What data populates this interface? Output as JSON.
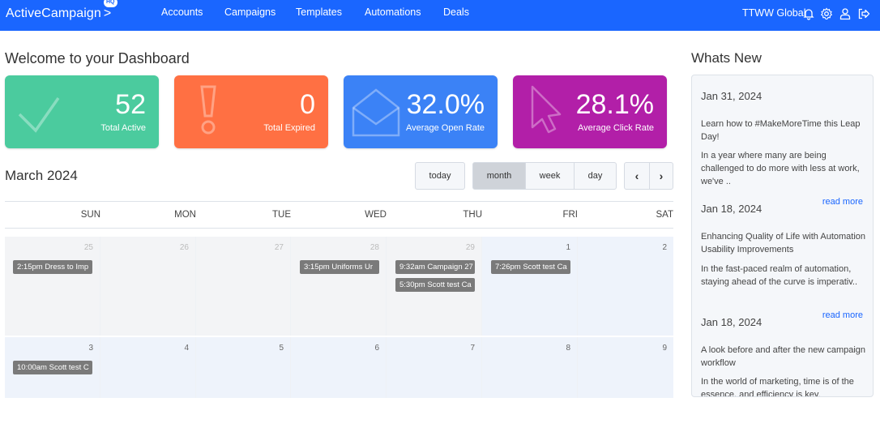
{
  "topbar": {
    "logo": "ActiveCampaign",
    "badge": "HQ",
    "nav": [
      "Accounts",
      "Campaigns",
      "Templates",
      "Automations",
      "Deals"
    ],
    "account_name": "TTWW Global"
  },
  "dashboard": {
    "title": "Welcome to your Dashboard",
    "cards": [
      {
        "value": "52",
        "label": "Total Active",
        "color": "#4bcb9e",
        "icon": "check-icon"
      },
      {
        "value": "0",
        "label": "Total Expired",
        "color": "#ff7043",
        "icon": "exclamation-icon"
      },
      {
        "value": "32.0%",
        "label": "Average Open Rate",
        "color": "#3b82f6",
        "icon": "envelope-icon"
      },
      {
        "value": "28.1%",
        "label": "Average Click Rate",
        "color": "#b21fa8",
        "icon": "cursor-icon"
      }
    ]
  },
  "calendar": {
    "title": "March 2024",
    "buttons": {
      "today": "today",
      "month": "month",
      "week": "week",
      "day": "day"
    },
    "days": [
      "SUN",
      "MON",
      "TUE",
      "WED",
      "THU",
      "FRI",
      "SAT"
    ],
    "weeks": [
      [
        "25",
        "26",
        "27",
        "28",
        "29",
        "1",
        "2"
      ],
      [
        "3",
        "4",
        "5",
        "6",
        "7",
        "8",
        "9"
      ]
    ],
    "events": {
      "sun25": "2:15pm Dress to Imp",
      "wed28": "3:15pm Uniforms Ur",
      "thu29a": "9:32am Campaign 27",
      "thu29b": "5:30pm Scott test Ca",
      "fri1": "7:26pm Scott test Ca",
      "sun3": "10:00am Scott test C"
    }
  },
  "whats_new": {
    "title": "Whats New",
    "read_more": "read more",
    "items": [
      {
        "date": "Jan 31, 2024",
        "headline": "Learn how to #MakeMoreTime this Leap Day!",
        "summary": "In a year where many are being challenged to do more with less at work, we've .."
      },
      {
        "date": "Jan 18, 2024",
        "headline": "Enhancing Quality of Life with Automation Usability Improvements",
        "summary": "In the fast-paced realm of automation, staying ahead of the curve is imperativ.."
      },
      {
        "date": "Jan 18, 2024",
        "headline": "A look before and after the new campaign workflow",
        "summary": "In the world of marketing, time is of the essence, and efficiency is key."
      }
    ]
  }
}
